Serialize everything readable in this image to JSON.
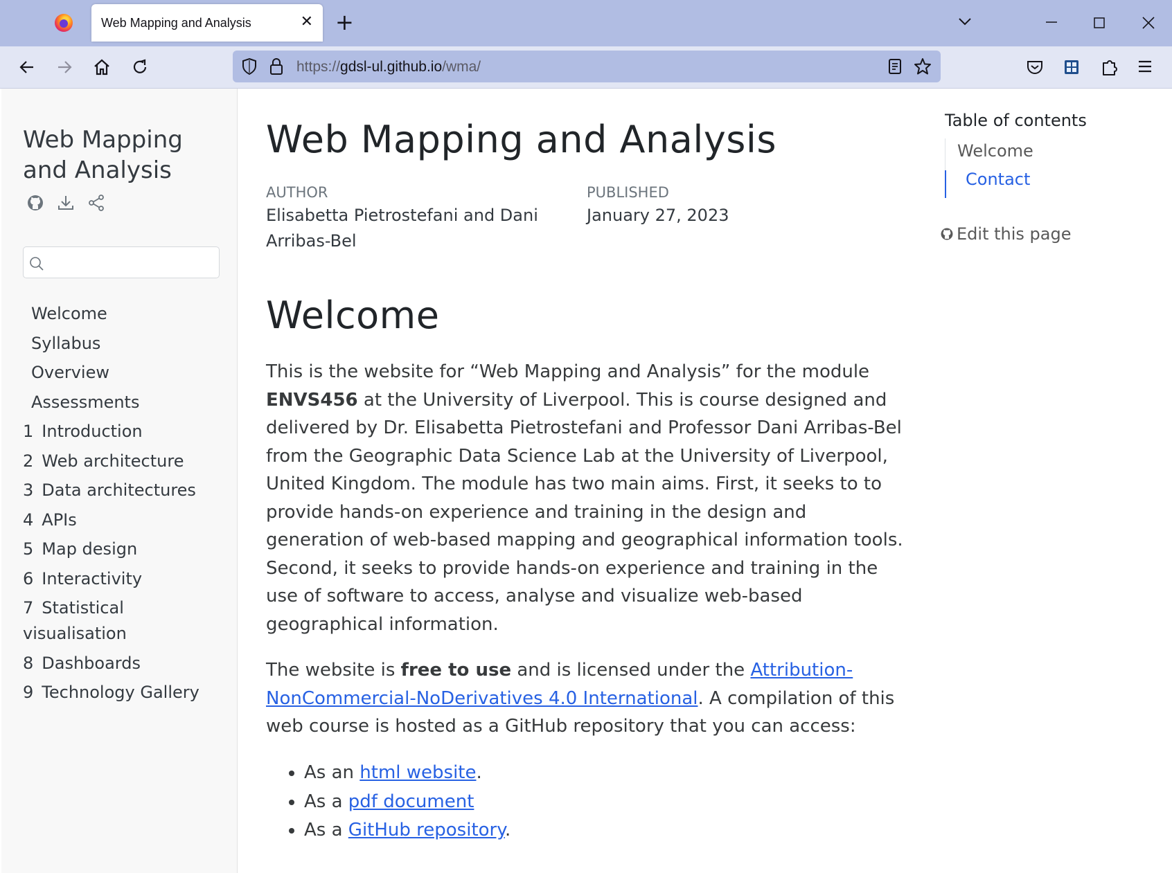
{
  "browser": {
    "tab_title": "Web Mapping and Analysis",
    "tab_close": "✕",
    "new_tab": "+",
    "url_scheme": "https://",
    "url_host": "gdsl-ul.github.io",
    "url_path": "/wma/"
  },
  "sidebar": {
    "title": "Web Mapping and Analysis",
    "search_placeholder": "",
    "items": [
      {
        "num": "",
        "label": "Welcome"
      },
      {
        "num": "",
        "label": "Syllabus"
      },
      {
        "num": "",
        "label": "Overview"
      },
      {
        "num": "",
        "label": "Assessments"
      },
      {
        "num": "1",
        "label": "Introduction"
      },
      {
        "num": "2",
        "label": "Web architecture"
      },
      {
        "num": "3",
        "label": "Data architectures"
      },
      {
        "num": "4",
        "label": "APIs"
      },
      {
        "num": "5",
        "label": "Map design"
      },
      {
        "num": "6",
        "label": "Interactivity"
      },
      {
        "num": "7",
        "label": "Statistical visualisation"
      },
      {
        "num": "8",
        "label": "Dashboards"
      },
      {
        "num": "9",
        "label": "Technology Gallery"
      }
    ]
  },
  "main": {
    "title": "Web Mapping and Analysis",
    "author_label": "AUTHOR",
    "author_value": "Elisabetta Pietrostefani and Dani Arribas-Bel",
    "published_label": "PUBLISHED",
    "published_value": "January 27, 2023",
    "section_title": "Welcome",
    "para1_a": "This is the website for “Web Mapping and Analysis” for the module ",
    "para1_bold": "ENVS456",
    "para1_b": " at the University of Liverpool. This is course designed and delivered by Dr. Elisabetta Pietrostefani and Professor Dani Arribas-Bel from the Geographic Data Science Lab at the University of Liverpool, United Kingdom. The module has two main aims. First, it seeks to to provide hands-on experience and training in the design and generation of web-based mapping and geographical information tools. Second, it seeks to provide hands-on experience and training in the use of software to access, analyse and visualize web-based geographical information.",
    "para2_a": "The website is ",
    "para2_bold": "free to use",
    "para2_b": " and is licensed under the ",
    "para2_link": "Attribution-NonCommercial-NoDerivatives 4.0 International",
    "para2_c": ". A compilation of this web course is hosted as a GitHub repository that you can access:",
    "bullets": [
      {
        "pre": "As an ",
        "link": "html website",
        "post": "."
      },
      {
        "pre": "As a ",
        "link": "pdf document",
        "post": ""
      },
      {
        "pre": "As a ",
        "link": "GitHub repository",
        "post": "."
      }
    ]
  },
  "toc": {
    "title": "Table of contents",
    "items": [
      "Welcome",
      "Contact"
    ],
    "edit_label": "Edit this page"
  },
  "colors": {
    "accent": "#2761e3",
    "chrome": "#b1bde3"
  }
}
